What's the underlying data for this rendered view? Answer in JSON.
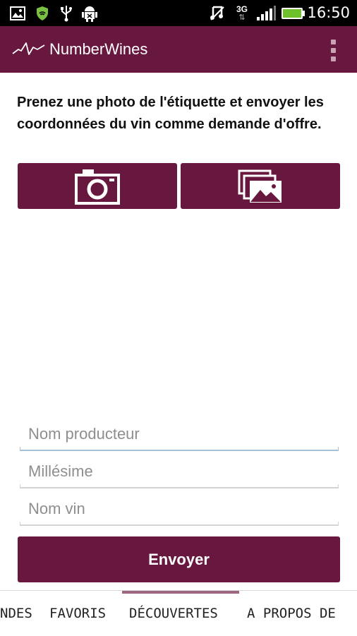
{
  "status_bar": {
    "time": "16:50",
    "network": "3G",
    "icons": [
      "image-icon",
      "shield-icon",
      "usb-icon",
      "android-debug-icon",
      "mute-icon",
      "signal-icon",
      "battery-icon"
    ]
  },
  "app": {
    "title": "NumberWines",
    "logo": "wave-logo-icon",
    "menu_icon": "overflow-menu-icon",
    "accent_color": "#68173f"
  },
  "main": {
    "instructions": "Prenez une photo de l'étiquette et envoyer les coordonnées du vin comme demande d'offre.",
    "camera_icon": "camera-icon",
    "gallery_icon": "gallery-icon"
  },
  "form": {
    "producer_placeholder": "Nom producteur",
    "vintage_placeholder": "Millésime",
    "wine_name_placeholder": "Nom vin",
    "submit_label": "Envoyer"
  },
  "tabs": [
    {
      "label": "NDES"
    },
    {
      "label": "FAVORIS"
    },
    {
      "label": "DÉCOUVERTES"
    },
    {
      "label": "A PROPOS DE"
    }
  ],
  "active_tab": "DÉCOUVERTES"
}
